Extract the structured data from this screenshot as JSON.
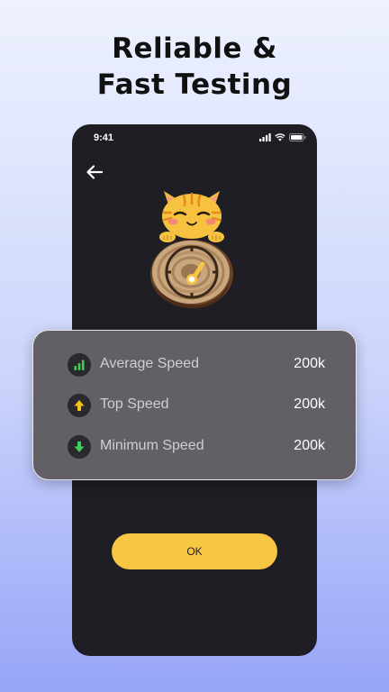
{
  "headline": {
    "line1": "Reliable &",
    "line2": "Fast Testing"
  },
  "phone": {
    "status_bar": {
      "time": "9:41"
    },
    "ok_button": {
      "label": "OK"
    }
  },
  "stats": {
    "items": [
      {
        "icon": "bar-chart-icon",
        "label": "Average Speed",
        "value": "200k"
      },
      {
        "icon": "arrow-up-icon",
        "label": "Top Speed",
        "value": "200k"
      },
      {
        "icon": "arrow-down-icon",
        "label": "Minimum Speed",
        "value": "200k"
      }
    ]
  },
  "colors": {
    "accent": "#f7c744",
    "phone_bg": "#1e1e24",
    "card_bg": "#626066",
    "icon_green": "#3fcf5a",
    "icon_yellow": "#f5c518"
  }
}
